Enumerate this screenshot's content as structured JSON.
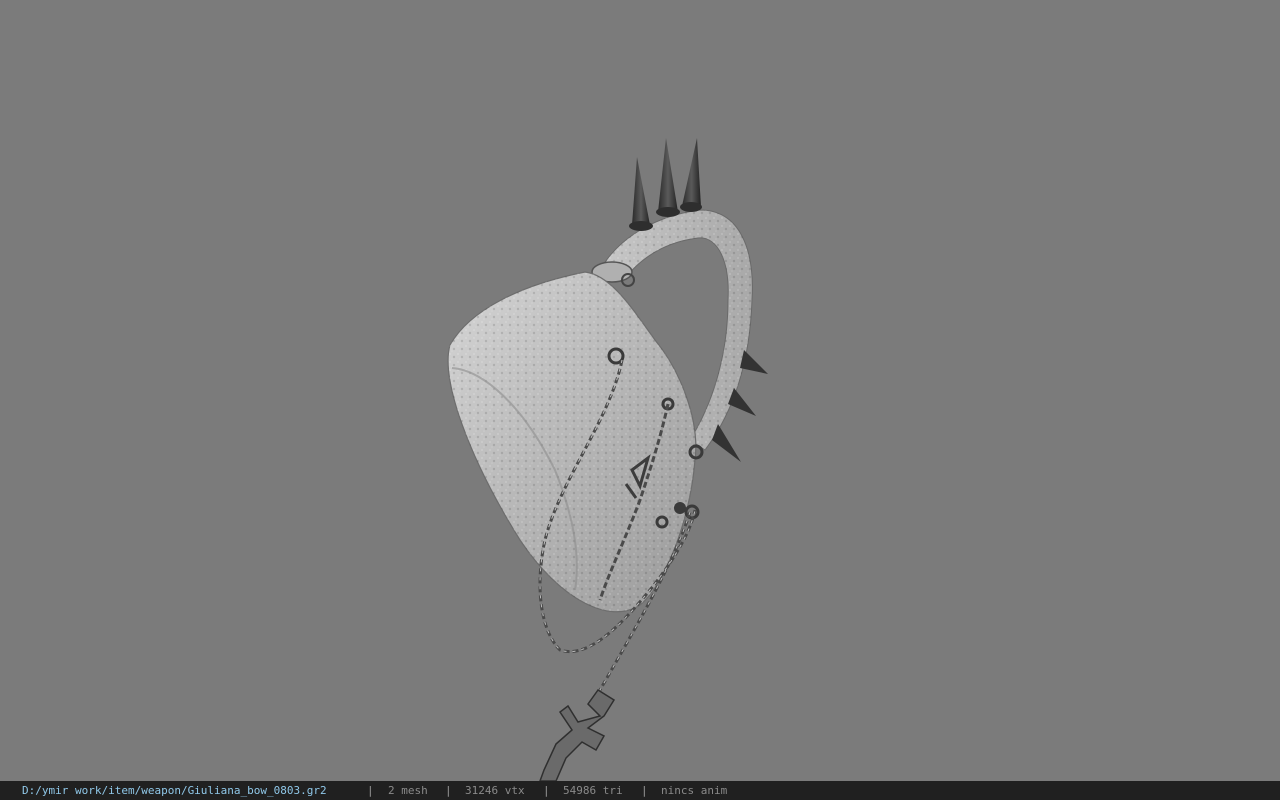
{
  "viewport": {
    "background": "#7b7b7b",
    "model": "Giuliana_bow_0803"
  },
  "status": {
    "file_path": "D:/ymir work/item/weapon/Giuliana_bow_0803.gr2",
    "separator": "|",
    "mesh_count": "2 mesh",
    "vertex_count": "31246 vtx",
    "triangle_count": "54986 tri",
    "anim_state": "nincs anim",
    "path_color": "#8fc7e8",
    "text_color": "#8a8a8a"
  }
}
